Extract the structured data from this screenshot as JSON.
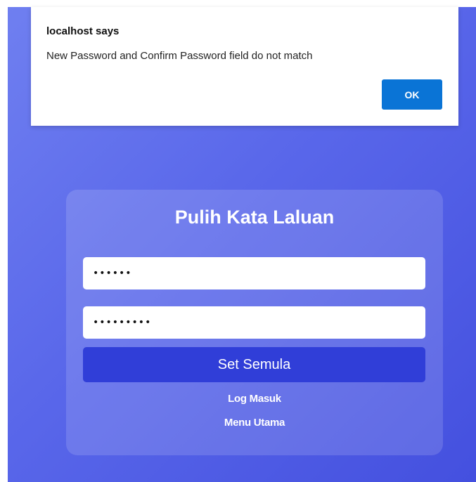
{
  "alert": {
    "title": "localhost says",
    "message": "New Password and Confirm Password field do not match",
    "ok_label": "OK"
  },
  "form": {
    "title": "Pulih Kata Laluan",
    "new_password_value": "••••••",
    "confirm_password_value": "•••••••••",
    "submit_label": "Set Semula",
    "links": {
      "login": "Log Masuk",
      "main_menu": "Menu Utama"
    }
  },
  "colors": {
    "background_gradient_start": "#6f7ff0",
    "background_gradient_end": "#4450df",
    "submit_button": "#303ed8",
    "ok_button": "#0a74d6"
  }
}
